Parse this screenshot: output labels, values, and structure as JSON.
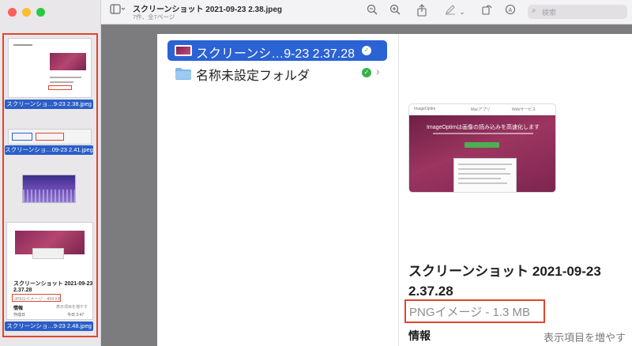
{
  "window": {
    "title": "スクリーンショット 2021-09-23 2.38.jpeg",
    "subtitle": "7件、全7ページ"
  },
  "toolbar": {
    "search_placeholder": "検索",
    "icons": [
      "sidebar-toggle-icon",
      "zoom-out-icon",
      "zoom-in-icon",
      "share-icon",
      "markup-pen-icon",
      "rotate-icon",
      "annotate-icon",
      "search-icon"
    ]
  },
  "sidebar": {
    "thumbnails": [
      {
        "label": "スクリーンショ…9-23 2.38.jpeg"
      },
      {
        "label": "スクリーンショ…09-23 2.41.jpeg"
      },
      {
        "label": ""
      },
      {
        "label": "スクリーンショ…9-23 2.48.jpeg",
        "doc_title_line1": "スクリーンショット 2021-09-23",
        "doc_title_line2": "2.37.28",
        "doc_kind": "JPEGイメージ - 454 KB",
        "doc_info": "情報",
        "doc_more": "表示項目を増やす",
        "doc_created_label": "作成日",
        "doc_created_value": "今日 2:47"
      }
    ]
  },
  "browser": {
    "rows": [
      {
        "label": "スクリーンシ…9-23 2.37.28",
        "selected": true,
        "status": "✓"
      },
      {
        "label": "名称未設定フォルダ",
        "selected": false,
        "status": "✓",
        "chevron": "›"
      }
    ]
  },
  "preview": {
    "tabs": [
      "ImageOptim",
      "Macアプリ",
      "Webサービス"
    ],
    "heading": "ImageOptimは画像の読み込みを高速化します",
    "title_line1": "スクリーンショット 2021-09-23",
    "title_line2": "2.37.28",
    "kind": "PNGイメージ - 1.3 MB",
    "info_label": "情報",
    "show_more": "表示項目を増やす"
  },
  "colors": {
    "accent": "#2b62d4",
    "highlight": "#e0452d",
    "check": "#37b14a"
  }
}
